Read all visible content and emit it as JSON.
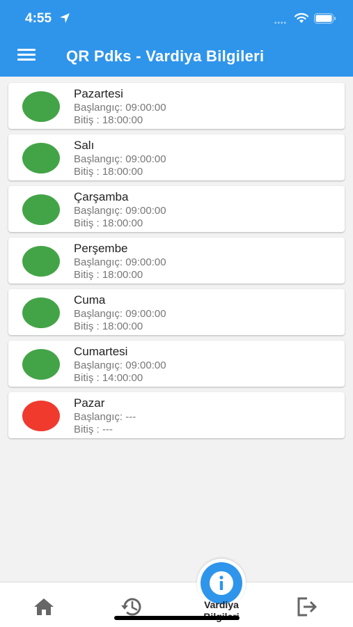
{
  "status_bar": {
    "time": "4:55",
    "icons": [
      "location-arrow-icon",
      "cellular-dots-icon",
      "wifi-icon",
      "battery-icon"
    ]
  },
  "header": {
    "title": "QR Pdks - Vardiya Bilgileri",
    "menu_icon": "hamburger-menu-icon",
    "background": "#2f95eb"
  },
  "shifts": [
    {
      "day": "Pazartesi",
      "start": "Başlangıç: 09:00:00",
      "end": "Bitiş : 18:00:00",
      "status_color": "#43a447"
    },
    {
      "day": "Salı",
      "start": "Başlangıç: 09:00:00",
      "end": "Bitiş : 18:00:00",
      "status_color": "#43a447"
    },
    {
      "day": "Çarşamba",
      "start": "Başlangıç: 09:00:00",
      "end": "Bitiş : 18:00:00",
      "status_color": "#43a447"
    },
    {
      "day": "Perşembe",
      "start": "Başlangıç: 09:00:00",
      "end": "Bitiş : 18:00:00",
      "status_color": "#43a447"
    },
    {
      "day": "Cuma",
      "start": "Başlangıç: 09:00:00",
      "end": "Bitiş : 18:00:00",
      "status_color": "#43a447"
    },
    {
      "day": "Cumartesi",
      "start": "Başlangıç: 09:00:00",
      "end": "Bitiş : 14:00:00",
      "status_color": "#43a447"
    },
    {
      "day": "Pazar",
      "start": "Başlangıç: ---",
      "end": "Bitiş : ---",
      "status_color": "#f03a2e"
    }
  ],
  "tabbar": {
    "tabs": [
      {
        "icon": "home-icon"
      },
      {
        "icon": "history-icon"
      },
      {
        "icon": "info-icon",
        "label": "Vardiya Bilgileri",
        "active": true
      },
      {
        "icon": "logout-icon"
      }
    ],
    "active_color": "#2f95eb",
    "inactive_color": "#666666"
  }
}
